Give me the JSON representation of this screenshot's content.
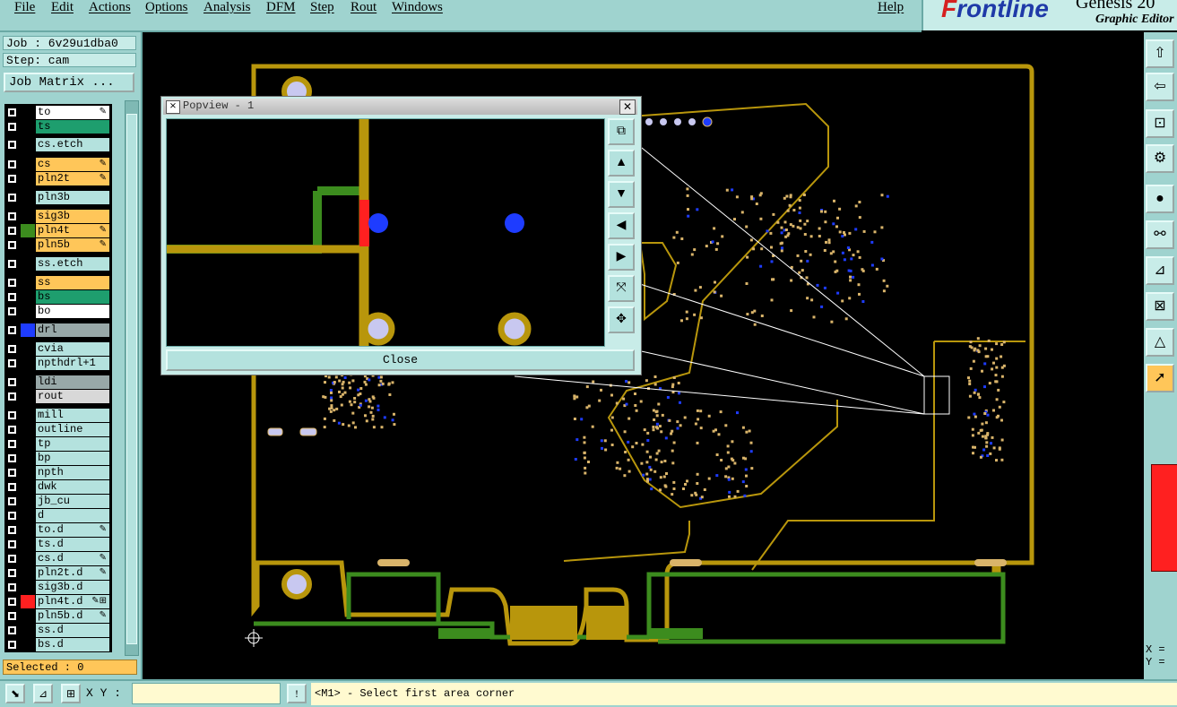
{
  "menu": [
    "File",
    "Edit",
    "Actions",
    "Options",
    "Analysis",
    "DFM",
    "Step",
    "Rout",
    "Windows"
  ],
  "help": "Help",
  "brand": {
    "logo_f": "F",
    "logo_rest": "rontline",
    "product": "Genesis 20",
    "subtitle": "Graphic Editor"
  },
  "job": "Job : 6v29u1dba0",
  "step": "Step: cam",
  "job_matrix": "Job Matrix ...",
  "layers": [
    {
      "name": "to",
      "bg": "#ffffff",
      "color": "#000000",
      "lock": "✎"
    },
    {
      "name": "ts",
      "bg": "#1e9e6e",
      "color": "#000000",
      "lock": ""
    },
    {
      "name": "cs.etch",
      "bg": "#b4e2de",
      "color": "#000000",
      "lock": ""
    },
    {
      "name": "cs",
      "bg": "#ffc659",
      "color": "#000000",
      "lock": "✎"
    },
    {
      "name": "pln2t",
      "bg": "#ffc659",
      "color": "#000000",
      "lock": "✎"
    },
    {
      "name": "pln3b",
      "bg": "#b4e2de",
      "color": "#000000",
      "lock": ""
    },
    {
      "name": "sig3b",
      "bg": "#ffc659",
      "color": "#000000",
      "lock": ""
    },
    {
      "name": "pln4t",
      "bg": "#ffc659",
      "color": "#3c8c1e",
      "lock": "✎"
    },
    {
      "name": "pln5b",
      "bg": "#ffc659",
      "color": "#000000",
      "lock": "✎"
    },
    {
      "name": "ss.etch",
      "bg": "#b4e2de",
      "color": "#000000",
      "lock": ""
    },
    {
      "name": "ss",
      "bg": "#ffc659",
      "color": "#000000",
      "lock": ""
    },
    {
      "name": "bs",
      "bg": "#1e9e6e",
      "color": "#000000",
      "lock": ""
    },
    {
      "name": "bo",
      "bg": "#ffffff",
      "color": "#000000",
      "lock": ""
    },
    {
      "name": "drl",
      "bg": "#98a8a8",
      "color": "#1e3cff",
      "lock": ""
    },
    {
      "name": "cvia",
      "bg": "#b4e2de",
      "color": "#000000",
      "lock": ""
    },
    {
      "name": "npthdrl+1",
      "bg": "#b4e2de",
      "color": "#000000",
      "lock": ""
    },
    {
      "name": "ldi",
      "bg": "#98a8a8",
      "color": "#000000",
      "lock": ""
    },
    {
      "name": "rout",
      "bg": "#d8d8d8",
      "color": "#000000",
      "lock": ""
    },
    {
      "name": "mill",
      "bg": "#b4e2de",
      "color": "#000000",
      "lock": ""
    },
    {
      "name": "outline",
      "bg": "#b4e2de",
      "color": "#000000",
      "lock": ""
    },
    {
      "name": "tp",
      "bg": "#b4e2de",
      "color": "#000000",
      "lock": ""
    },
    {
      "name": "bp",
      "bg": "#b4e2de",
      "color": "#000000",
      "lock": ""
    },
    {
      "name": "npth",
      "bg": "#b4e2de",
      "color": "#000000",
      "lock": ""
    },
    {
      "name": "dwk",
      "bg": "#b4e2de",
      "color": "#000000",
      "lock": ""
    },
    {
      "name": "jb_cu",
      "bg": "#b4e2de",
      "color": "#000000",
      "lock": ""
    },
    {
      "name": "d",
      "bg": "#b4e2de",
      "color": "#000000",
      "lock": ""
    },
    {
      "name": "to.d",
      "bg": "#b4e2de",
      "color": "#000000",
      "lock": "✎"
    },
    {
      "name": "ts.d",
      "bg": "#b4e2de",
      "color": "#000000",
      "lock": ""
    },
    {
      "name": "cs.d",
      "bg": "#b4e2de",
      "color": "#000000",
      "lock": "✎"
    },
    {
      "name": "pln2t.d",
      "bg": "#b4e2de",
      "color": "#000000",
      "lock": "✎"
    },
    {
      "name": "sig3b.d",
      "bg": "#b4e2de",
      "color": "#000000",
      "lock": ""
    },
    {
      "name": "pln4t.d",
      "bg": "#b4e2de",
      "color": "#ff2020",
      "lock": "✎⊞"
    },
    {
      "name": "pln5b.d",
      "bg": "#b4e2de",
      "color": "#000000",
      "lock": "✎"
    },
    {
      "name": "ss.d",
      "bg": "#b4e2de",
      "color": "#000000",
      "lock": ""
    },
    {
      "name": "bs.d",
      "bg": "#b4e2de",
      "color": "#000000",
      "lock": ""
    }
  ],
  "selected": "Selected : 0",
  "popview": {
    "title": "Popview - 1",
    "close": "Close"
  },
  "xy_label": "X Y :",
  "xy_input": "",
  "status": "<M1> - Select first area corner",
  "xy_readout": {
    "x": "X =",
    "y": "Y ="
  },
  "colors": {
    "panel": "#9fd3cf",
    "copper": "#b8960c",
    "green_trace": "#3c8c1e",
    "blue_pad": "#1e3cff",
    "red_pad": "#ff2020"
  }
}
